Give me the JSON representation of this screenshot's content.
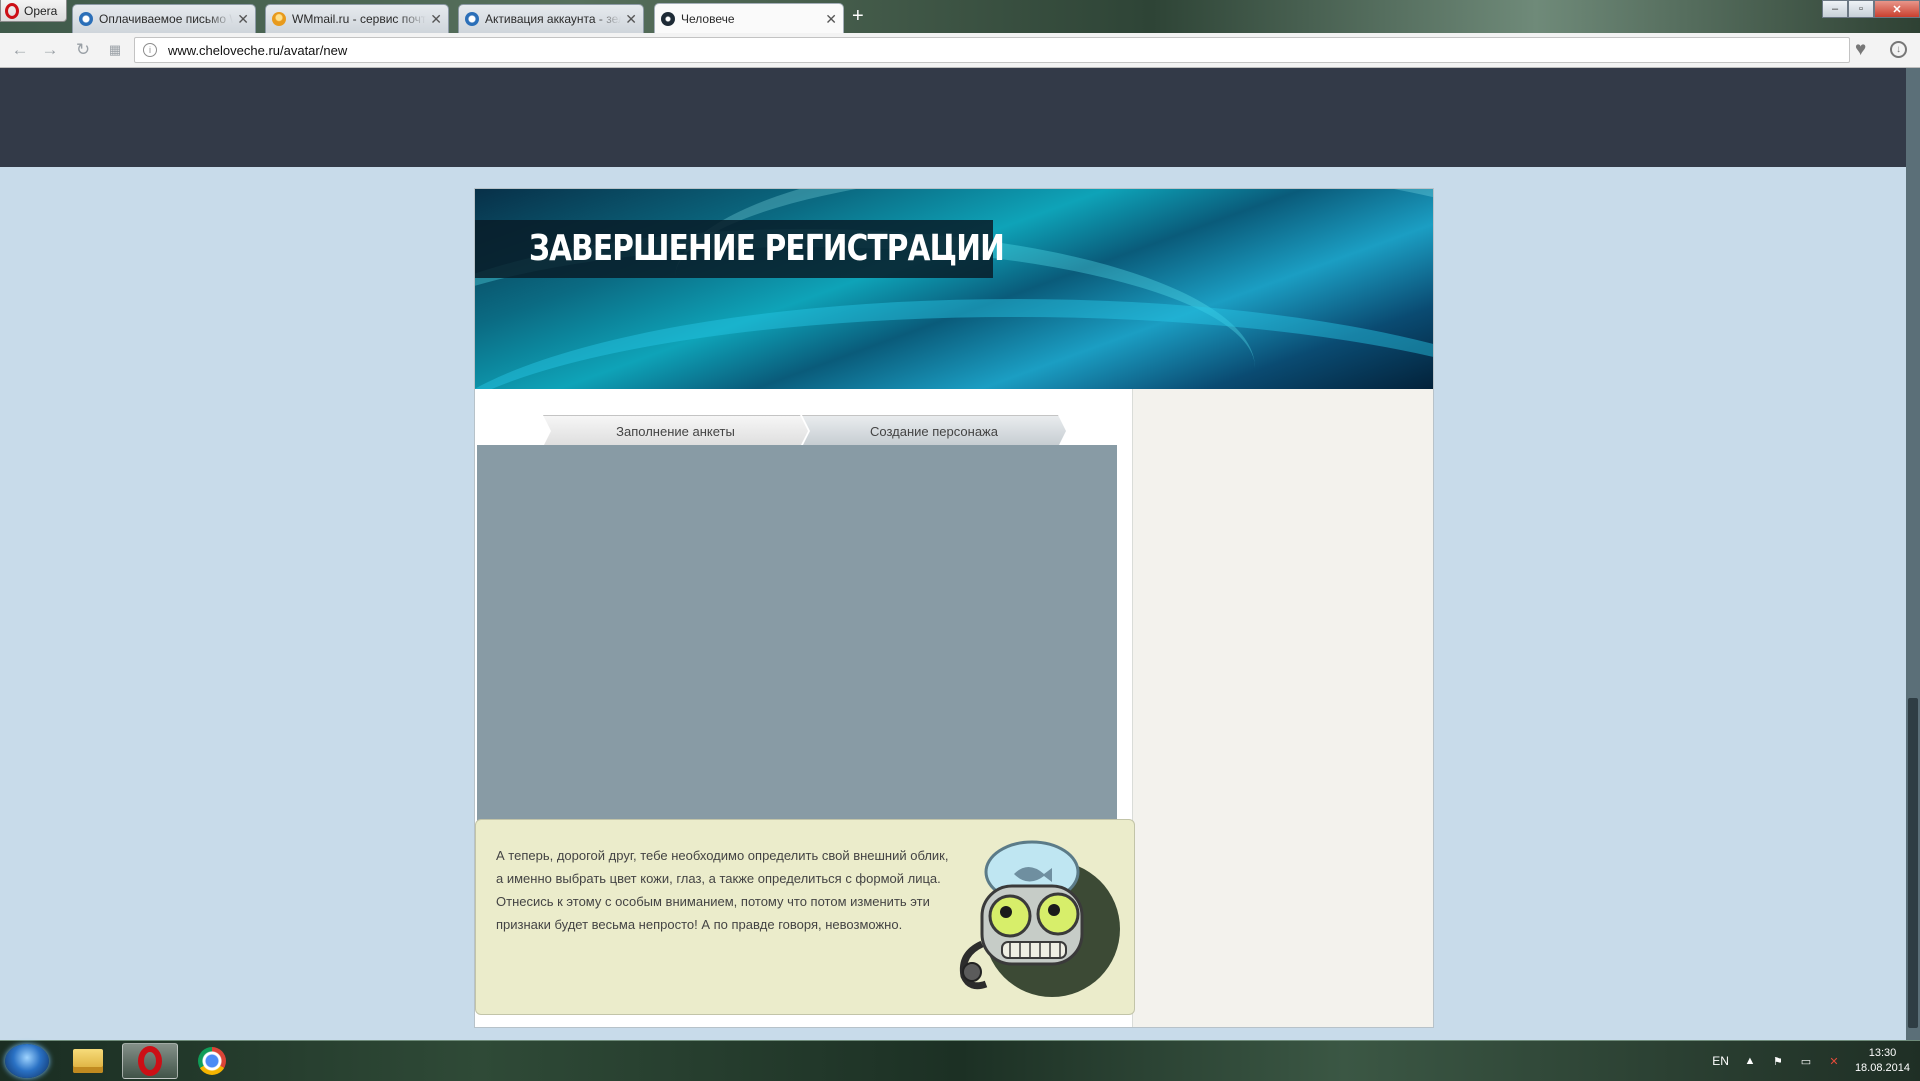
{
  "browser": {
    "menu_label": "Opera",
    "tabs": [
      {
        "label": "Оплачиваемое письмо W",
        "icon": "opera-mail-favicon"
      },
      {
        "label": "WMmail.ru - сервис почт",
        "icon": "wmmail-favicon"
      },
      {
        "label": "Активация аккаунта - зел",
        "icon": "opera-mail-favicon"
      },
      {
        "label": "Человече",
        "icon": "humanoid-favicon",
        "active": true
      }
    ],
    "url": "www.cheloveche.ru/avatar/new"
  },
  "page": {
    "banner_title": "ЗАВЕРШЕНИЕ РЕГИСТРАЦИИ",
    "steps": [
      "Заполнение анкеты",
      "Создание персонажа"
    ],
    "info_text": "А теперь, дорогой друг, тебе необходимо определить свой внешний облик, а именно выбрать цвет кожи, глаз, а также определиться с формой лица. Отнесись к этому с особым вниманием, потому что потом изменить эти признаки будет весьма непросто! А по правде говоря, невозможно."
  },
  "taskbar": {
    "apps": [
      "explorer-icon",
      "opera-icon",
      "chrome-icon"
    ],
    "language": "EN",
    "time": "13:30",
    "date": "18.08.2014"
  },
  "colors": {
    "site_header": "#333a48",
    "page_bg": "#c8dbea",
    "stage": "#889ba5",
    "info_box": "#ebeccb"
  }
}
